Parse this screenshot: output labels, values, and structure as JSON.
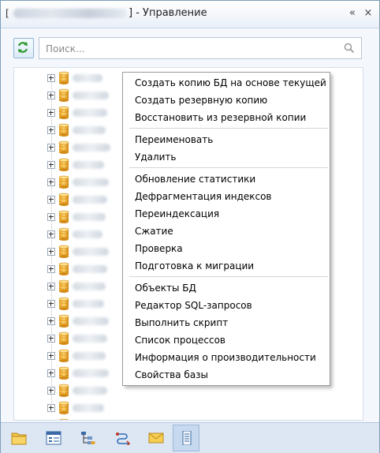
{
  "window": {
    "title_prefix": "[",
    "title": "] - Управление",
    "buttons": {
      "pin": "«",
      "close": "×"
    }
  },
  "search": {
    "placeholder": "Поиск..."
  },
  "context_menu": {
    "groups": [
      [
        "Создать копию БД на основе текущей",
        "Создать резервную копию",
        "Восстановить из резервной копии"
      ],
      [
        "Переименовать",
        "Удалить"
      ],
      [
        "Обновление статистики",
        "Дефрагментация индексов",
        "Переиндексация",
        "Сжатие",
        "Проверка",
        "Подготовка к миграции"
      ],
      [
        "Объекты БД",
        "Редактор SQL-запросов",
        "Выполнить скрипт",
        "Список процессов",
        "Информация о производительности",
        "Свойства базы"
      ]
    ]
  },
  "bottom_toolbar": {
    "icons": [
      "folder-icon",
      "window-list-icon",
      "tree-hierarchy-icon",
      "workflow-icon",
      "mail-icon",
      "server-icon"
    ],
    "active_index": 5
  },
  "colors": {
    "accent": "#2f6db5",
    "window_border": "#7f9db9"
  }
}
